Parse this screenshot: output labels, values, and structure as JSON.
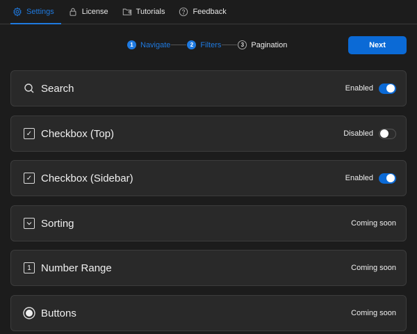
{
  "tabs": [
    {
      "label": "Settings",
      "icon": "gear-icon"
    },
    {
      "label": "License",
      "icon": "lock-icon"
    },
    {
      "label": "Tutorials",
      "icon": "folder-video-icon"
    },
    {
      "label": "Feedback",
      "icon": "help-circle-icon"
    }
  ],
  "stepper": [
    {
      "num": "1",
      "label": "Navigate"
    },
    {
      "num": "2",
      "label": "Filters"
    },
    {
      "num": "3",
      "label": "Pagination"
    }
  ],
  "next_label": "Next",
  "cards": [
    {
      "title": "Search",
      "status": "Enabled"
    },
    {
      "title": "Checkbox (Top)",
      "status": "Disabled"
    },
    {
      "title": "Checkbox (Sidebar)",
      "status": "Enabled"
    },
    {
      "title": "Sorting",
      "status": "Coming soon"
    },
    {
      "title": "Number Range",
      "status": "Coming soon"
    },
    {
      "title": "Buttons",
      "status": "Coming soon"
    }
  ],
  "number_icon_glyph": "1",
  "colors": {
    "accent": "#1f7ae0",
    "background": "#1c1c1c",
    "card": "#292929"
  }
}
